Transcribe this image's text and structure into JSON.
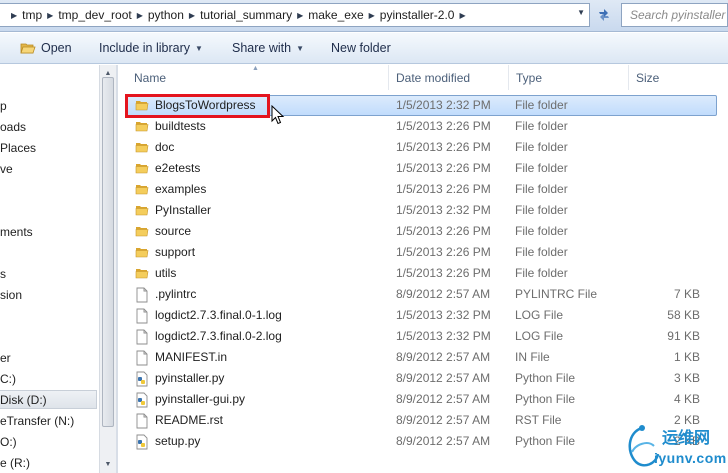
{
  "address": {
    "crumbs": [
      "tmp",
      "tmp_dev_root",
      "python",
      "tutorial_summary",
      "make_exe",
      "pyinstaller-2.0"
    ],
    "search_placeholder": "Search pyinstaller"
  },
  "toolbar": {
    "open_label": "Open",
    "include_label": "Include in library",
    "share_label": "Share with",
    "new_folder_label": "New folder"
  },
  "nav": {
    "items": [
      "p",
      "oads",
      " Places",
      "ve",
      "ments",
      "s",
      "sion",
      "er",
      "C:)",
      "Disk (D:)",
      "eTransfer (N:)",
      "O:)",
      "e (R:)"
    ],
    "selected_index": 9
  },
  "columns": {
    "name": "Name",
    "date": "Date modified",
    "type": "Type",
    "size": "Size"
  },
  "files": [
    {
      "name": "BlogsToWordpress",
      "date": "1/5/2013 2:32 PM",
      "type": "File folder",
      "size": "",
      "icon": "folder-icon"
    },
    {
      "name": "buildtests",
      "date": "1/5/2013 2:26 PM",
      "type": "File folder",
      "size": "",
      "icon": "folder-icon"
    },
    {
      "name": "doc",
      "date": "1/5/2013 2:26 PM",
      "type": "File folder",
      "size": "",
      "icon": "folder-icon"
    },
    {
      "name": "e2etests",
      "date": "1/5/2013 2:26 PM",
      "type": "File folder",
      "size": "",
      "icon": "folder-icon"
    },
    {
      "name": "examples",
      "date": "1/5/2013 2:26 PM",
      "type": "File folder",
      "size": "",
      "icon": "folder-icon"
    },
    {
      "name": "PyInstaller",
      "date": "1/5/2013 2:32 PM",
      "type": "File folder",
      "size": "",
      "icon": "folder-icon"
    },
    {
      "name": "source",
      "date": "1/5/2013 2:26 PM",
      "type": "File folder",
      "size": "",
      "icon": "folder-icon"
    },
    {
      "name": "support",
      "date": "1/5/2013 2:26 PM",
      "type": "File folder",
      "size": "",
      "icon": "folder-icon"
    },
    {
      "name": "utils",
      "date": "1/5/2013 2:26 PM",
      "type": "File folder",
      "size": "",
      "icon": "folder-icon"
    },
    {
      "name": ".pylintrc",
      "date": "8/9/2012 2:57 AM",
      "type": "PYLINTRC File",
      "size": "7 KB",
      "icon": "document-icon"
    },
    {
      "name": "logdict2.7.3.final.0-1.log",
      "date": "1/5/2013 2:32 PM",
      "type": "LOG File",
      "size": "58 KB",
      "icon": "document-icon"
    },
    {
      "name": "logdict2.7.3.final.0-2.log",
      "date": "1/5/2013 2:32 PM",
      "type": "LOG File",
      "size": "91 KB",
      "icon": "document-icon"
    },
    {
      "name": "MANIFEST.in",
      "date": "8/9/2012 2:57 AM",
      "type": "IN File",
      "size": "1 KB",
      "icon": "document-icon"
    },
    {
      "name": "pyinstaller.py",
      "date": "8/9/2012 2:57 AM",
      "type": "Python File",
      "size": "3 KB",
      "icon": "python-icon"
    },
    {
      "name": "pyinstaller-gui.py",
      "date": "8/9/2012 2:57 AM",
      "type": "Python File",
      "size": "4 KB",
      "icon": "python-icon"
    },
    {
      "name": "README.rst",
      "date": "8/9/2012 2:57 AM",
      "type": "RST File",
      "size": "2 KB",
      "icon": "document-icon"
    },
    {
      "name": "setup.py",
      "date": "8/9/2012 2:57 AM",
      "type": "Python File",
      "size": "2 KB",
      "icon": "python-icon"
    }
  ],
  "selected_file_index": 0,
  "watermark": {
    "line1": "运维网",
    "line2": "iyunv.com"
  },
  "colors": {
    "highlight": "#e4141e",
    "folder": "#e8b93a",
    "watermark": "#1f8ccd"
  }
}
